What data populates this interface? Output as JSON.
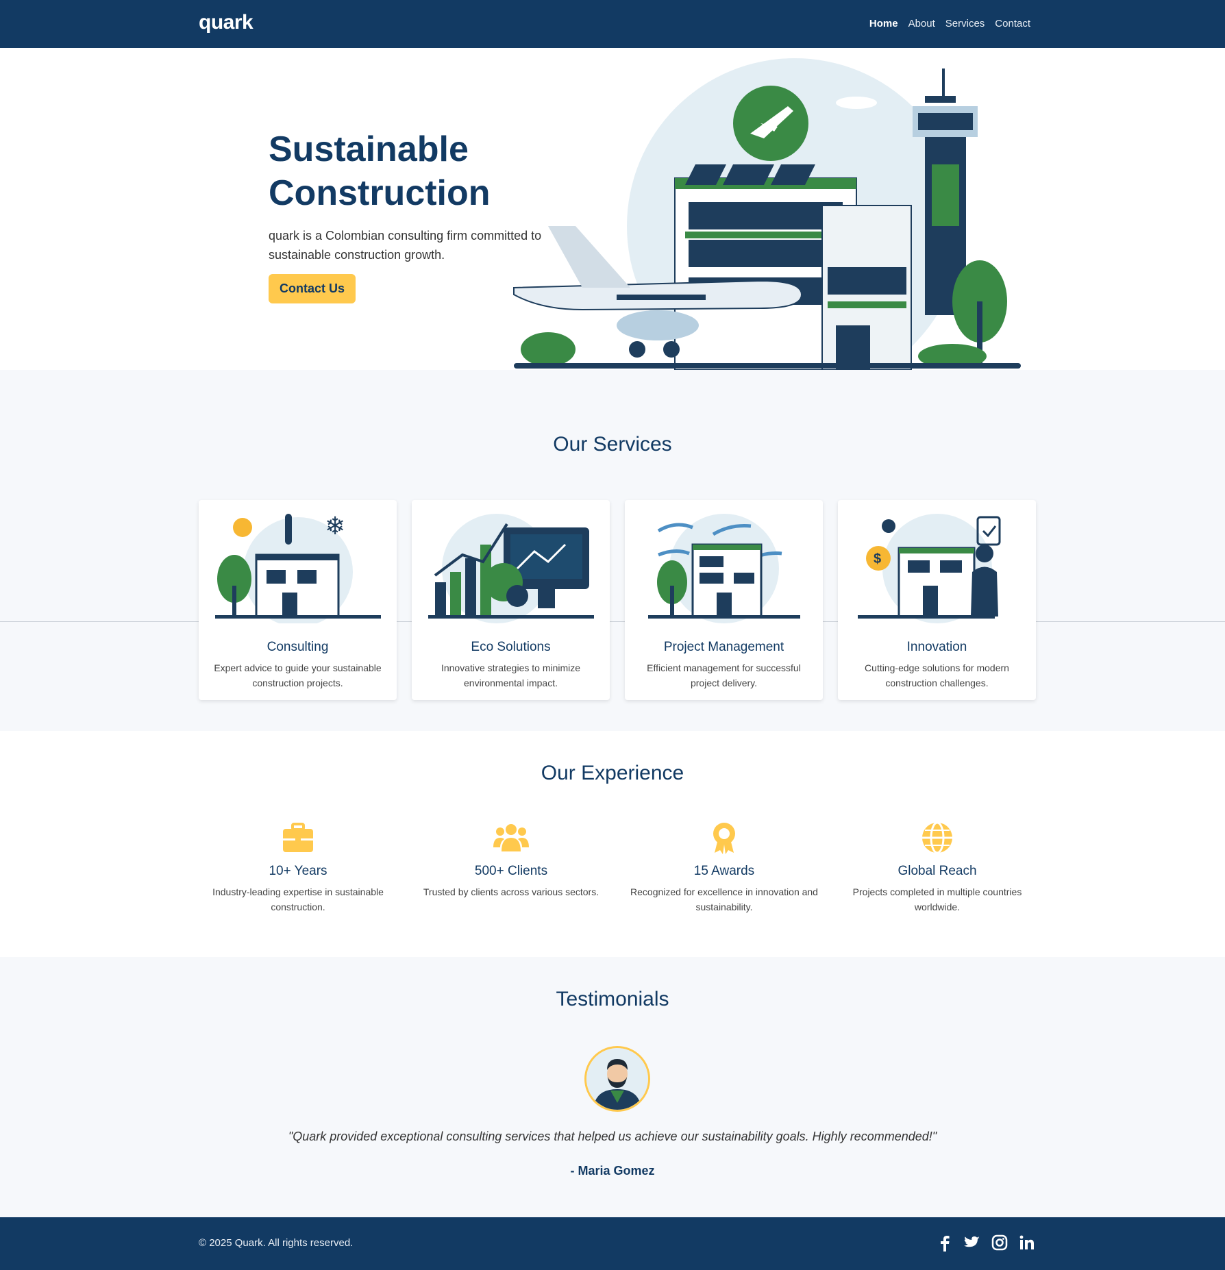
{
  "nav": {
    "brand": "quark",
    "links": [
      "Home",
      "About",
      "Services",
      "Contact"
    ]
  },
  "hero": {
    "title_line1": "Sustainable",
    "title_line2": "Construction",
    "description": "quark is a Colombian consulting firm committed to sustainable construction growth.",
    "cta": "Contact Us"
  },
  "services": {
    "title": "Our Services",
    "items": [
      {
        "title": "Consulting",
        "desc": "Expert advice to guide your sustainable construction projects."
      },
      {
        "title": "Eco Solutions",
        "desc": "Innovative strategies to minimize environmental impact."
      },
      {
        "title": "Project Management",
        "desc": "Efficient management for successful project delivery."
      },
      {
        "title": "Innovation",
        "desc": "Cutting-edge solutions for modern construction challenges."
      }
    ]
  },
  "experience": {
    "title": "Our Experience",
    "items": [
      {
        "icon": "briefcase-icon",
        "title": "10+ Years",
        "desc": "Industry-leading expertise in sustainable construction."
      },
      {
        "icon": "users-icon",
        "title": "500+ Clients",
        "desc": "Trusted by clients across various sectors."
      },
      {
        "icon": "award-icon",
        "title": "15 Awards",
        "desc": "Recognized for excellence in innovation and sustainability."
      },
      {
        "icon": "globe-icon",
        "title": "Global Reach",
        "desc": "Projects completed in multiple countries worldwide."
      }
    ]
  },
  "testimonials": {
    "title": "Testimonials",
    "quote": "\"Quark provided exceptional consulting services that helped us achieve our sustainability goals. Highly recommended!\"",
    "author": "- Maria Gomez"
  },
  "footer": {
    "copyright": "© 2025 Quark. All rights reserved.",
    "socials": [
      "facebook-icon",
      "twitter-icon",
      "instagram-icon",
      "linkedin-icon"
    ]
  },
  "colors": {
    "primary": "#123a63",
    "accent": "#ffc94d",
    "green": "#3a8a45",
    "section_bg": "#f6f8fb"
  }
}
